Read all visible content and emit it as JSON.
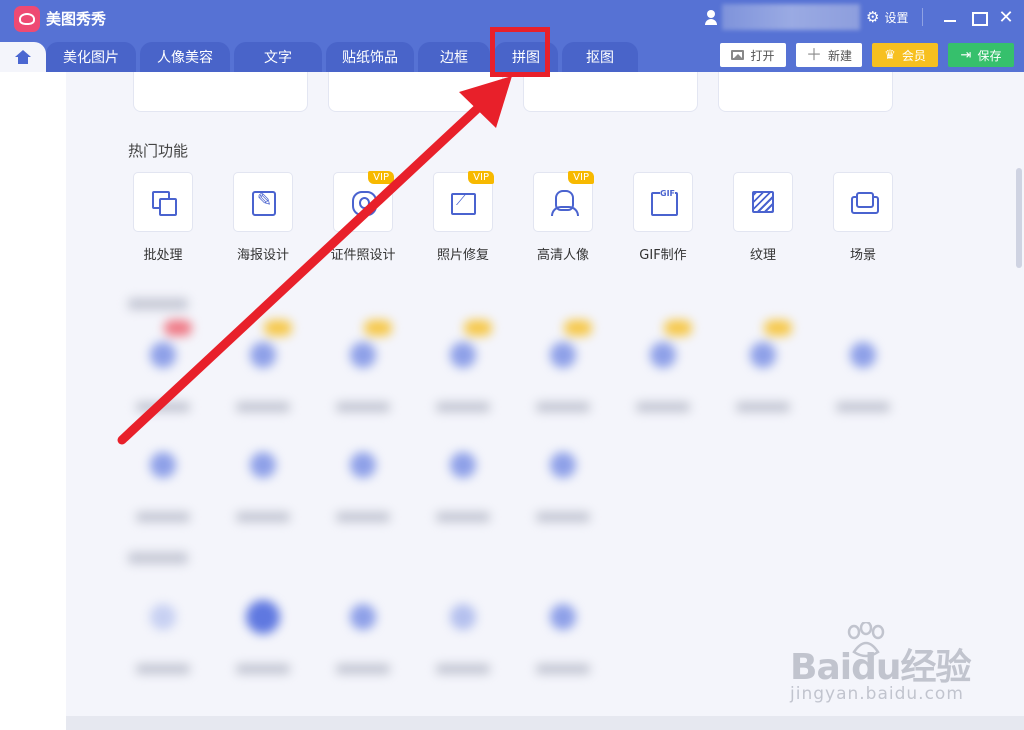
{
  "app": {
    "name": "美图秀秀"
  },
  "titlebar": {
    "settings_label": "设置"
  },
  "tabs": [
    {
      "label": "美化图片"
    },
    {
      "label": "人像美容"
    },
    {
      "label": "文字"
    },
    {
      "label": "贴纸饰品"
    },
    {
      "label": "边框"
    },
    {
      "label": "拼图"
    },
    {
      "label": "抠图"
    }
  ],
  "actions": {
    "open": "打开",
    "new": "新建",
    "vip": "会员",
    "save": "保存"
  },
  "hot_section": {
    "title": "热门功能",
    "items": [
      {
        "label": "批处理",
        "icon": "batch-icon",
        "vip": false
      },
      {
        "label": "海报设计",
        "icon": "poster-icon",
        "vip": false
      },
      {
        "label": "证件照设计",
        "icon": "id-photo-icon",
        "vip": true
      },
      {
        "label": "照片修复",
        "icon": "photo-repair-icon",
        "vip": true
      },
      {
        "label": "高清人像",
        "icon": "hd-portrait-icon",
        "vip": true
      },
      {
        "label": "GIF制作",
        "icon": "gif-icon",
        "vip": false
      },
      {
        "label": "纹理",
        "icon": "texture-icon",
        "vip": false
      },
      {
        "label": "场景",
        "icon": "scene-icon",
        "vip": false
      }
    ],
    "vip_badge": "VIP"
  },
  "colors": {
    "titlebar": "#5672d4",
    "tab": "#4964c9",
    "highlight": "#e8202a",
    "vip": "#f7b900",
    "save": "#36c06c"
  },
  "watermark": {
    "brand": "Baidu经验",
    "url": "jingyan.baidu.com"
  }
}
